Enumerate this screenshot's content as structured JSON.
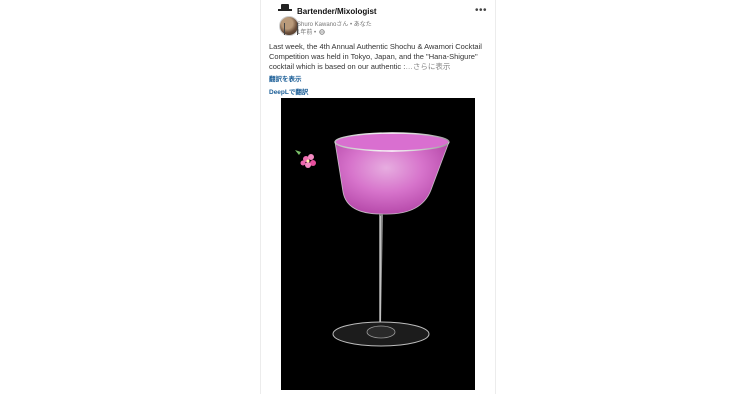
{
  "post": {
    "page_name": "Bartender/Mixologist",
    "author_line": "Shuro Kawanoさん • あなた",
    "time": "1年前 •",
    "more": "•••",
    "text": "Last week, the 4th Annual Authentic Shochu & Awamori Cocktail Competition was held in Tokyo, Japan, and the \"Hana-Shigure\" cocktail which is based on our authentic :",
    "see_more": "…さらに表示",
    "translate_link": "翻訳を表示",
    "deepl_link": "DeepLで翻訳"
  },
  "icons": {
    "avatar": "bartender-avatar-icon",
    "globe": "globe-icon",
    "more": "more-options-icon"
  },
  "colors": {
    "link": "#1b5e97",
    "drink": "#e27ad6",
    "photo_bg": "#000000"
  }
}
